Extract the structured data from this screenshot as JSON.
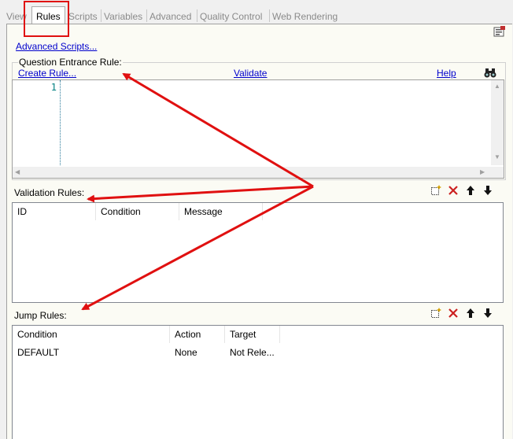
{
  "tabs": [
    {
      "label": "View",
      "active": false
    },
    {
      "label": "Rules",
      "active": true
    },
    {
      "label": "Scripts",
      "active": false
    },
    {
      "label": "Variables",
      "active": false
    },
    {
      "label": "Advanced",
      "active": false
    },
    {
      "label": "Quality Control",
      "active": false
    },
    {
      "label": "Web Rendering",
      "active": false
    }
  ],
  "advanced_scripts_link": "Advanced Scripts...",
  "entrance": {
    "title": "Question Entrance Rule:",
    "create_rule": "Create Rule...",
    "validate": "Validate",
    "help": "Help",
    "line_number": "1"
  },
  "validation": {
    "title": "Validation Rules:",
    "columns": [
      "ID",
      "Condition",
      "Message"
    ]
  },
  "jump": {
    "title": "Jump Rules:",
    "columns": [
      "Condition",
      "Action",
      "Target"
    ],
    "rows": [
      {
        "condition": "DEFAULT",
        "action": "None",
        "target": "Not Rele..."
      }
    ]
  },
  "colors": {
    "annotation_red": "#e01010",
    "link_blue": "#0000cc",
    "line_number_teal": "#008080"
  },
  "icons": [
    "export-icon",
    "find-binoculars-icon",
    "new-rule-icon",
    "delete-icon",
    "move-up-icon",
    "move-down-icon"
  ]
}
